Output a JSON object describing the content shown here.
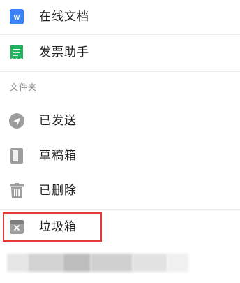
{
  "menu": {
    "items": [
      {
        "label": "在线文档",
        "icon": "online-doc-icon",
        "color": "#3b82f6"
      },
      {
        "label": "发票助手",
        "icon": "invoice-icon",
        "color": "#22b35e"
      }
    ]
  },
  "folders": {
    "section_label": "文件夹",
    "items": [
      {
        "label": "已发送",
        "icon": "sent-icon"
      },
      {
        "label": "草稿箱",
        "icon": "drafts-icon"
      },
      {
        "label": "已删除",
        "icon": "trash-icon"
      },
      {
        "label": "垃圾箱",
        "icon": "spam-icon"
      }
    ]
  },
  "colors": {
    "gray_icon": "#9e9e9e",
    "highlight": "#e53935"
  }
}
